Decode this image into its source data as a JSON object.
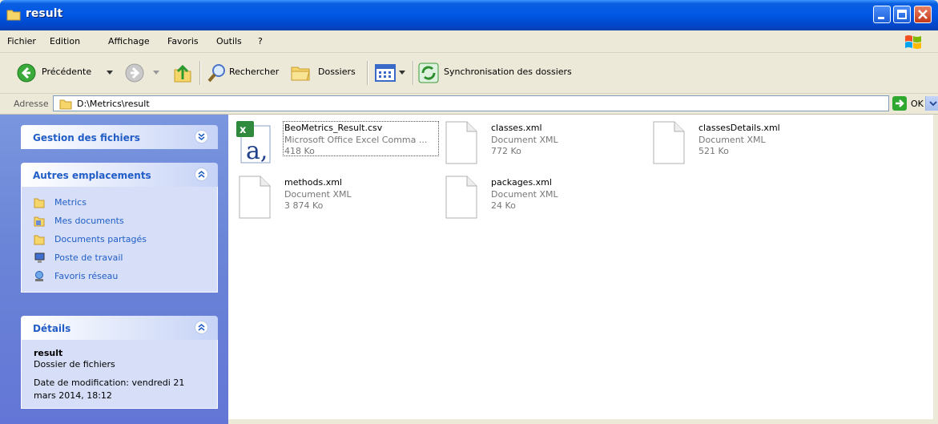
{
  "window": {
    "title": "result"
  },
  "menu": [
    "Fichier",
    "Edition",
    "Affichage",
    "Favoris",
    "Outils",
    "?"
  ],
  "toolbar": {
    "back_label": "Précédente",
    "search_label": "Rechercher",
    "folders_label": "Dossiers",
    "sync_label": "Synchronisation des dossiers"
  },
  "address": {
    "label": "Adresse",
    "path": "D:\\Metrics\\result",
    "go_label": "OK"
  },
  "sidebar": {
    "file_tasks_title": "Gestion des fichiers",
    "other_places_title": "Autres emplacements",
    "other_places": [
      {
        "label": "Metrics",
        "icon": "folder-icon"
      },
      {
        "label": "Mes documents",
        "icon": "my-documents-icon"
      },
      {
        "label": "Documents partagés",
        "icon": "folder-icon"
      },
      {
        "label": "Poste de travail",
        "icon": "my-computer-icon"
      },
      {
        "label": "Favoris réseau",
        "icon": "network-icon"
      }
    ],
    "details_title": "Détails",
    "details": {
      "name": "result",
      "type": "Dossier de fichiers",
      "modified": "Date de modification: vendredi 21 mars 2014, 18:12"
    }
  },
  "files": [
    {
      "name": "BeoMetrics_Result.csv",
      "type": "Microsoft Office Excel Comma ...",
      "size": "418 Ko",
      "icon": "excel-csv-icon"
    },
    {
      "name": "classes.xml",
      "type": "Document XML",
      "size": "772 Ko",
      "icon": "document-icon"
    },
    {
      "name": "classesDetails.xml",
      "type": "Document XML",
      "size": "521 Ko",
      "icon": "document-icon"
    },
    {
      "name": "methods.xml",
      "type": "Document XML",
      "size": "3 874 Ko",
      "icon": "document-icon"
    },
    {
      "name": "packages.xml",
      "type": "Document XML",
      "size": "24 Ko",
      "icon": "document-icon"
    }
  ],
  "colors": {
    "titlebar": "#0058e6",
    "taskpane": "#6b86d7",
    "link": "#215dc6"
  }
}
